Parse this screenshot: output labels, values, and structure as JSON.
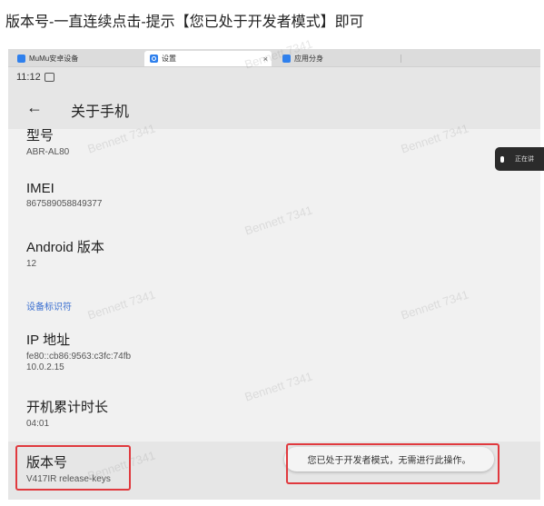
{
  "caption": "版本号-一直连续点击-提示【您已处于开发者模式】即可",
  "tabs": [
    {
      "label": "MuMu安卓设备",
      "icon": "mumu-icon"
    },
    {
      "label": "设置",
      "icon": "gear-icon",
      "close": "×"
    },
    {
      "label": "应用分身",
      "icon": "app-clone-icon"
    }
  ],
  "status": {
    "time": "11:12"
  },
  "appbar": {
    "back": "←",
    "title": "关于手机"
  },
  "items": {
    "model": {
      "title": "型号",
      "value": "ABR-AL80"
    },
    "imei": {
      "title": "IMEI",
      "value": "867589058849377"
    },
    "android": {
      "title": "Android 版本",
      "value": "12"
    },
    "section": "设备标识符",
    "ip": {
      "title": "IP 地址",
      "value1": "fe80::cb86:9563:c3fc:74fb",
      "value2": "10.0.2.15"
    },
    "uptime": {
      "title": "开机累计时长",
      "value": "04:01"
    },
    "build": {
      "title": "版本号",
      "value": "V417IR release-keys"
    }
  },
  "toast": "您已处于开发者模式，无需进行此操作。",
  "mic_label": "正在讲",
  "watermark": "Bennett 7341"
}
